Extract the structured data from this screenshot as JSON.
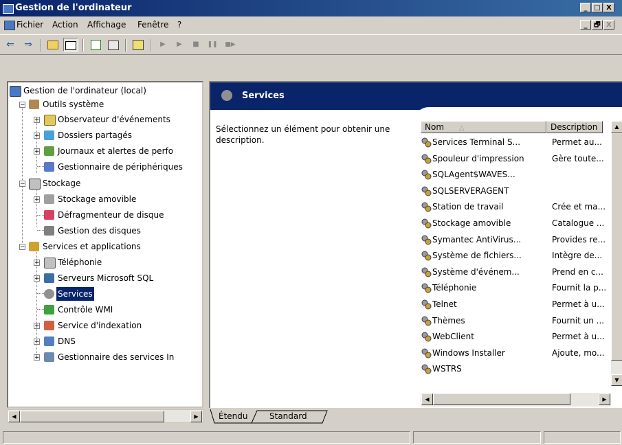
{
  "window": {
    "title": "Gestion de l'ordinateur",
    "controls": [
      "_",
      "□",
      "X"
    ],
    "child_controls": [
      "_",
      "🗗",
      "X"
    ]
  },
  "menu": [
    "Fichier",
    "Action",
    "Affichage",
    "Fenêtre",
    "?"
  ],
  "toolbar": {
    "back": "⇐",
    "forward": "⇒",
    "play": "▶",
    "play2": "▶",
    "stop": "■",
    "pause": "❚❚",
    "resume": "■▶"
  },
  "tree": {
    "root": "Gestion de l'ordinateur (local)",
    "outils": "Outils système",
    "observateur": "Observateur d'événements",
    "dossiers": "Dossiers partagés",
    "journaux": "Journaux et alertes de perfo",
    "gestionnaire": "Gestionnaire de périphériques",
    "stockage": "Stockage",
    "stockage_amovible": "Stockage amovible",
    "defrag": "Défragmenteur de disque",
    "disques": "Gestion des disques",
    "services_apps": "Services et applications",
    "telephonie": "Téléphonie",
    "sql": "Serveurs Microsoft SQL",
    "services": "Services",
    "wmi": "Contrôle WMI",
    "indexation": "Service d'indexation",
    "dns": "DNS",
    "iis": "Gestionnaire des services In"
  },
  "panel": {
    "title": "Services",
    "description": "Sélectionnez un élément pour obtenir une description."
  },
  "list": {
    "col_name": "Nom",
    "col_desc": "Description",
    "sort_glyph": "△",
    "rows": [
      {
        "name": "Services Terminal S...",
        "desc": "Permet au..."
      },
      {
        "name": "Spouleur d'impression",
        "desc": "Gère toute..."
      },
      {
        "name": "SQLAgent$WAVES...",
        "desc": ""
      },
      {
        "name": "SQLSERVERAGENT",
        "desc": ""
      },
      {
        "name": "Station de travail",
        "desc": "Crée et ma..."
      },
      {
        "name": "Stockage amovible",
        "desc": "Catalogue ..."
      },
      {
        "name": "Symantec AntiVirus...",
        "desc": "Provides re..."
      },
      {
        "name": "Système de fichiers...",
        "desc": "Intègre de..."
      },
      {
        "name": "Système d'événem...",
        "desc": "Prend en c..."
      },
      {
        "name": "Téléphonie",
        "desc": "Fournit la p..."
      },
      {
        "name": "Telnet",
        "desc": "Permet à u..."
      },
      {
        "name": "Thèmes",
        "desc": "Fournit un ..."
      },
      {
        "name": "WebClient",
        "desc": "Permet à u..."
      },
      {
        "name": "Windows Installer",
        "desc": "Ajoute, mo..."
      },
      {
        "name": "WSTRS",
        "desc": ""
      }
    ]
  },
  "tabs": [
    "Étendu",
    "Standard"
  ],
  "colors": {
    "title_blue": "#0a246a",
    "face": "#d4d0c8",
    "selection": "#0a246a"
  }
}
